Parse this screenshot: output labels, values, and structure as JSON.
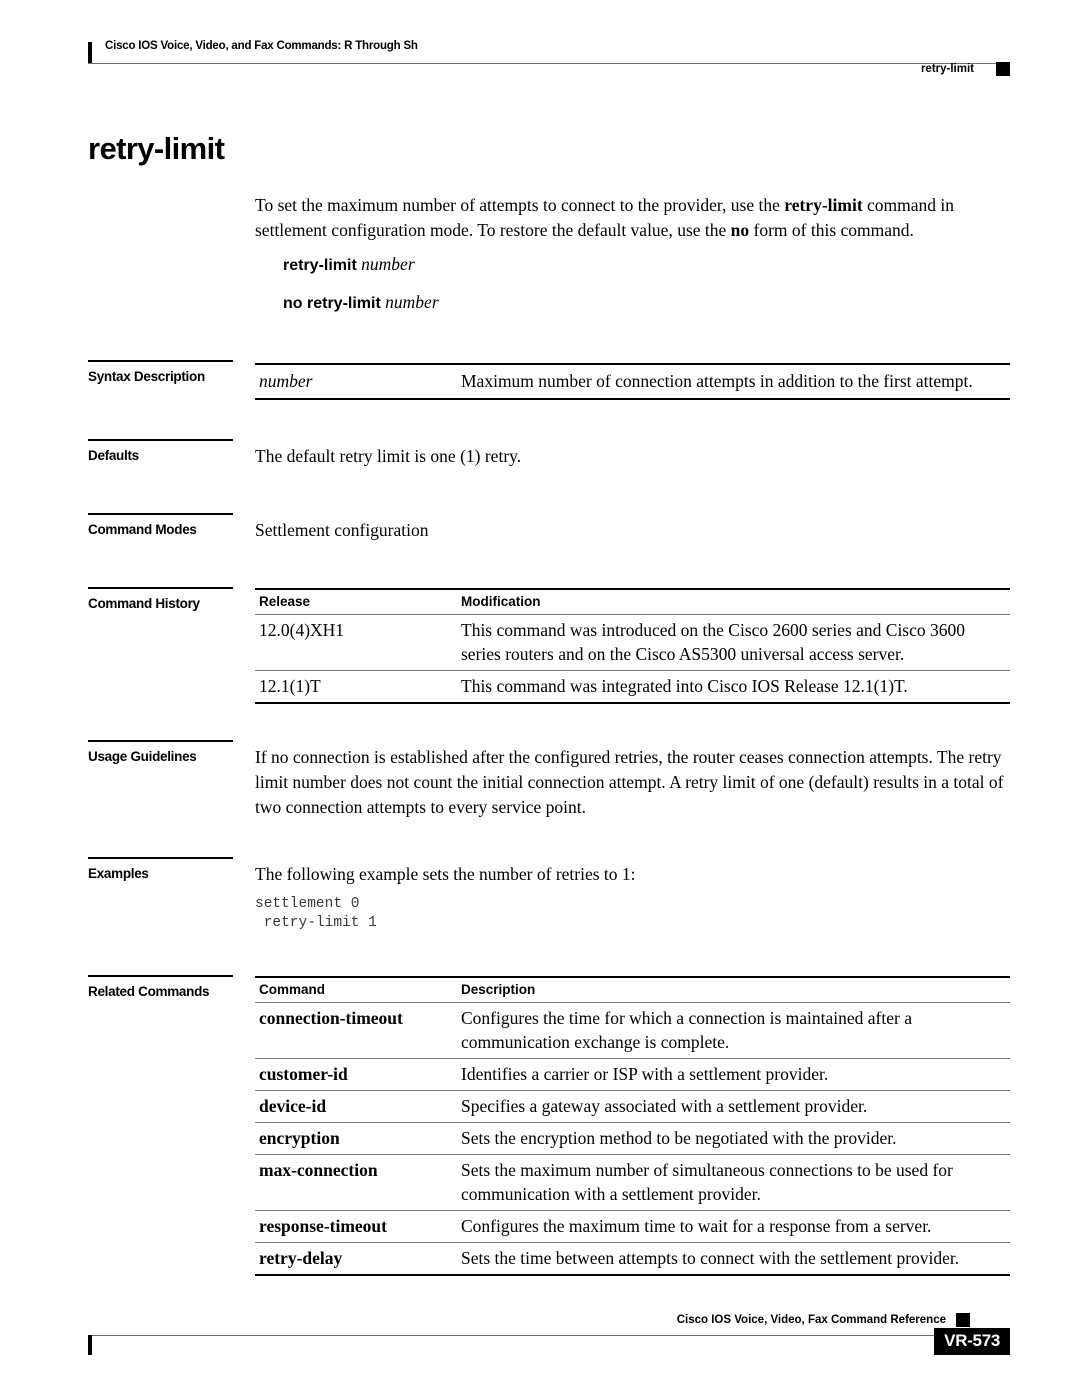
{
  "header": {
    "left_text": "Cisco IOS Voice, Video, and Fax Commands: R Through Sh",
    "right_text": "retry-limit",
    "marker": "black-square"
  },
  "command": {
    "title": "retry-limit",
    "description_html": "To set the maximum number of attempts to connect to the provider, use the <b>retry-limit</b> command in settlement configuration mode. To restore the default value, use the <b>no</b> form of this command.",
    "syntax_forms": [
      {
        "command": "retry-limit",
        "argument": "number"
      },
      {
        "command": "no retry-limit",
        "argument": "number"
      }
    ]
  },
  "sections": {
    "syntax_description": {
      "label": "Syntax Description",
      "rows": [
        {
          "term": "number",
          "definition": "Maximum number of connection attempts in addition to the first attempt."
        }
      ]
    },
    "defaults": {
      "label": "Defaults",
      "text": "The default retry limit is one (1) retry."
    },
    "command_modes": {
      "label": "Command Modes",
      "text": "Settlement configuration"
    },
    "command_history": {
      "label": "Command History",
      "columns": [
        "Release",
        "Modification"
      ],
      "rows": [
        {
          "release": "12.0(4)XH1",
          "modification": "This command was introduced on the Cisco 2600 series and Cisco 3600 series routers and on the Cisco AS5300 universal access server."
        },
        {
          "release": "12.1(1)T",
          "modification": "This command was integrated into Cisco IOS Release 12.1(1)T."
        }
      ]
    },
    "usage_guidelines": {
      "label": "Usage Guidelines",
      "text": "If no connection is established after the configured retries, the router ceases connection attempts. The retry limit number does not count the initial connection attempt. A retry limit of one (default) results in a total of two connection attempts to every service point."
    },
    "examples": {
      "label": "Examples",
      "intro": "The following example sets the number of retries to 1:",
      "code": "settlement 0\n retry-limit 1"
    },
    "related_commands": {
      "label": "Related Commands",
      "columns": [
        "Command",
        "Description"
      ],
      "rows": [
        {
          "command": "connection-timeout",
          "description": "Configures the time for which a connection is maintained after a communication exchange is complete."
        },
        {
          "command": "customer-id",
          "description": "Identifies a carrier or ISP with a settlement provider."
        },
        {
          "command": "device-id",
          "description": "Specifies a gateway associated with a settlement provider."
        },
        {
          "command": "encryption",
          "description": "Sets the encryption method to be negotiated with the provider."
        },
        {
          "command": "max-connection",
          "description": "Sets the maximum number of simultaneous connections to be used for communication with a settlement provider."
        },
        {
          "command": "response-timeout",
          "description": "Configures the maximum time to wait for a response from a server."
        },
        {
          "command": "retry-delay",
          "description": "Sets the time between attempts to connect with the settlement provider."
        }
      ]
    }
  },
  "footer": {
    "text": "Cisco IOS Voice, Video, Fax Command Reference",
    "page_number": "VR-573",
    "marker": "black-square"
  }
}
